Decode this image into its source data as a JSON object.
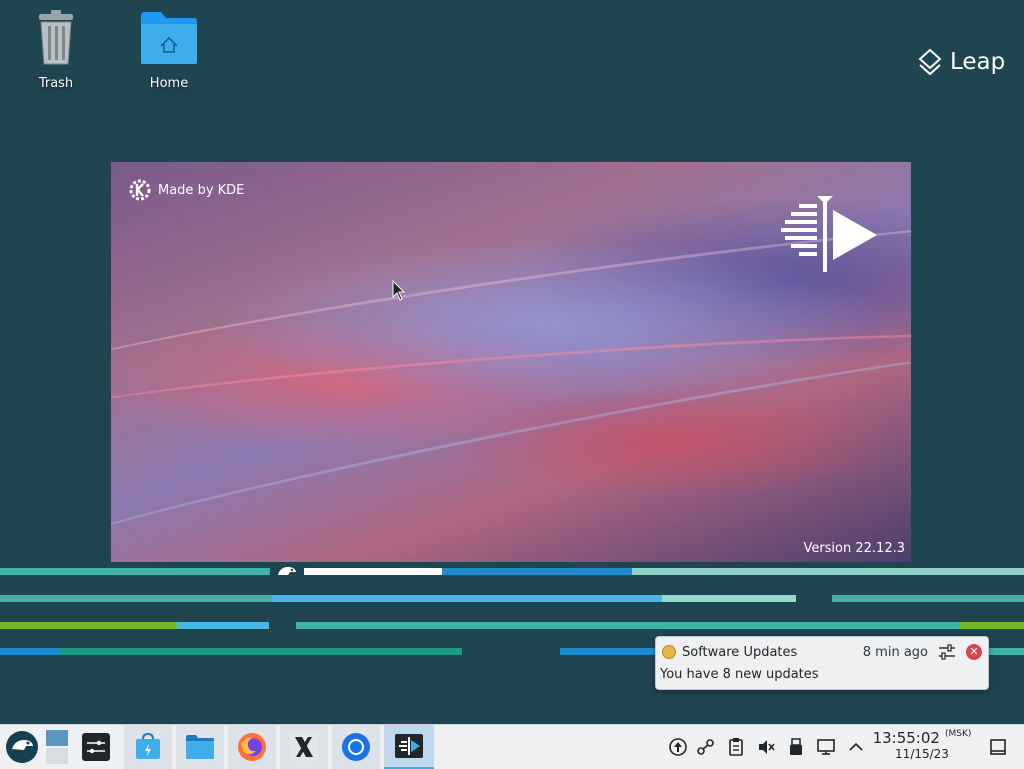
{
  "desktop": {
    "icons": [
      {
        "label": "Trash",
        "icon": "trash-icon"
      },
      {
        "label": "Home",
        "icon": "home-folder-icon"
      }
    ],
    "brand": "Leap"
  },
  "splash": {
    "made_by": "Made by KDE",
    "version": "Version 22.12.3"
  },
  "notification": {
    "app_name": "Software Updates",
    "time": "8 min ago",
    "body": "You have 8 new updates"
  },
  "taskbar": {
    "items": [
      {
        "name": "application-launcher",
        "icon": "opensuse-icon"
      },
      {
        "name": "pager",
        "icon": "virtual-desktop-pager-icon"
      },
      {
        "name": "system-settings",
        "icon": "settings-icon"
      },
      {
        "name": "discover",
        "icon": "discover-icon"
      },
      {
        "name": "dolphin",
        "icon": "file-manager-icon"
      },
      {
        "name": "firefox",
        "icon": "firefox-icon"
      },
      {
        "name": "xorg-app",
        "icon": "x-icon"
      },
      {
        "name": "chromium",
        "icon": "chromium-icon"
      },
      {
        "name": "kdenlive",
        "icon": "kdenlive-icon"
      }
    ],
    "tray_icons": [
      "update-icon",
      "network-icon",
      "clipboard-icon",
      "volume-muted-icon",
      "usb-icon",
      "display-icon",
      "expand-tray-icon"
    ],
    "clock": {
      "time": "13:55:02",
      "timezone": "(MSK)",
      "date": "11/15/23"
    },
    "show_desktop": "show-desktop-icon"
  },
  "colors": {
    "background": "#1f4551",
    "accent": "#3daee9",
    "close": "#da4453"
  }
}
